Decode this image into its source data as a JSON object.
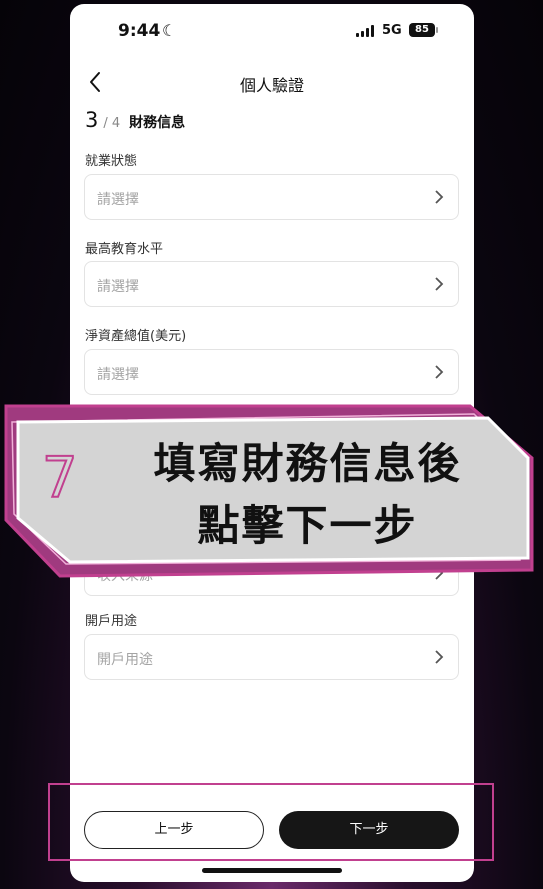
{
  "status": {
    "time": "9:44",
    "network": "5G",
    "battery": "85"
  },
  "header": {
    "title": "個人驗證"
  },
  "progress": {
    "current": "3",
    "total_text": "/ 4",
    "step_name": "財務信息"
  },
  "fields": [
    {
      "label": "就業狀態",
      "placeholder": "請選擇"
    },
    {
      "label": "最高教育水平",
      "placeholder": "請選擇"
    },
    {
      "label": "淨資產總值(美元)",
      "placeholder": "請選擇"
    },
    {
      "label": "",
      "placeholder": "收入來源"
    },
    {
      "label": "開戶用途",
      "placeholder": "開戶用途"
    }
  ],
  "footer": {
    "prev_label": "上一步",
    "next_label": "下一步"
  },
  "overlay": {
    "number": "7",
    "line1": "填寫財務信息後",
    "line2": "點擊下一步"
  },
  "colors": {
    "accent": "#c1408f",
    "banner_fill": "#d4d4d4"
  }
}
